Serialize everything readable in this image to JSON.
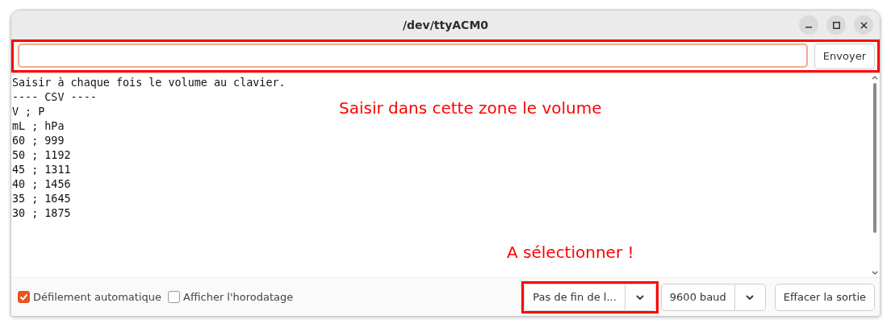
{
  "window": {
    "title": "/dev/ttyACM0"
  },
  "send_bar": {
    "highlighted": true,
    "button": "Envoyer"
  },
  "output_lines": [
    "Saisir à chaque fois le volume au clavier.",
    "---- CSV ----",
    "V ; P",
    "mL ; hPa",
    "60 ; 999",
    "50 ; 1192",
    "45 ; 1311",
    "40 ; 1456",
    "35 ; 1645",
    "30 ; 1875"
  ],
  "annotations": [
    {
      "text": "Saisir dans cette zone le volume"
    },
    {
      "text": "A sélectionner !"
    }
  ],
  "footer": {
    "checkboxes": [
      {
        "label": "Défilement automatique",
        "checked": true
      },
      {
        "label": "Afficher l'horodatage",
        "checked": false
      }
    ],
    "line_ending": {
      "value": "Pas de fin de l...",
      "highlighted": true
    },
    "baud": {
      "value": "9600 baud"
    },
    "clear_button": "Effacer la sortie"
  }
}
